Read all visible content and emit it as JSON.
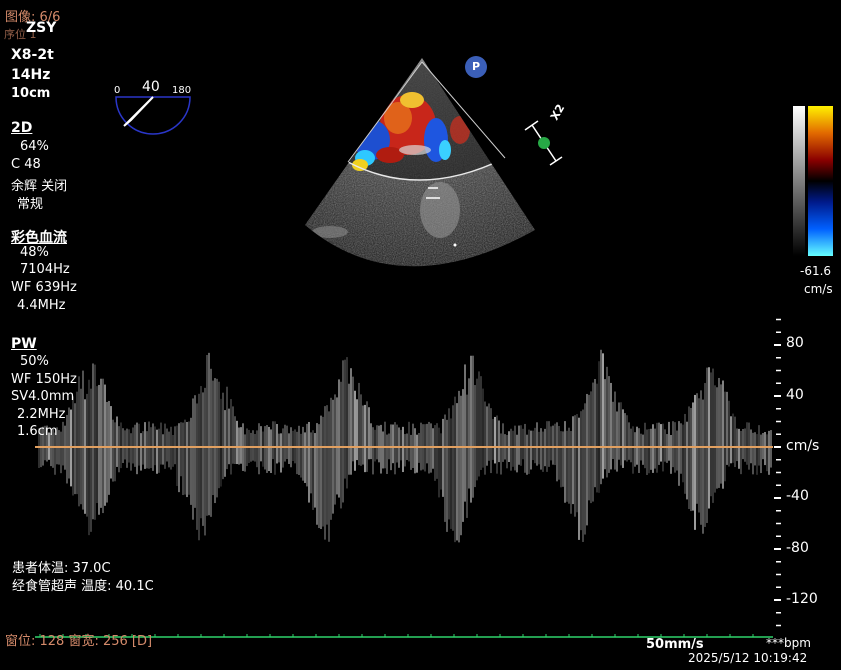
{
  "header": {
    "image_label": "图像: 6/6",
    "preset_partial": "ZSY",
    "underlay_text": "序位 1",
    "probe": "X8-2t",
    "frame_rate": "14Hz",
    "depth": "10cm"
  },
  "angle_indicator": {
    "min": "0",
    "value": "40",
    "max": "180"
  },
  "params_2d": {
    "heading": "2D",
    "gain": "64%",
    "compression": "C 48",
    "persistence": "余辉 关闭",
    "mode": "常规"
  },
  "params_color": {
    "heading": "彩色血流",
    "gain": "48%",
    "prf": "7104Hz",
    "wall_filter": "WF 639Hz",
    "frequency": "4.4MHz"
  },
  "params_pw": {
    "heading": "PW",
    "gain": "50%",
    "wall_filter": "WF 150Hz",
    "sample_volume": "SV4.0mm",
    "frequency": "2.2MHz",
    "gate_depth": "1.6cm"
  },
  "sector": {
    "p_badge": "P",
    "x2_label": "X2"
  },
  "colorbar": {
    "value": "-61.6",
    "unit": "cm/s"
  },
  "velocity_scale": {
    "ticks": [
      "80",
      "40",
      "cm/s",
      "-40",
      "-80",
      "-120"
    ],
    "tick_values": [
      80,
      40,
      0,
      -40,
      -80,
      -120
    ]
  },
  "footer": {
    "patient_temp": "患者体温: 37.0C",
    "probe_temp": "经食管超声 温度: 40.1C",
    "window": "窗位: 128 窗宽: 256 [D]",
    "sweep_speed": "50mm/s",
    "heart_rate": "***bpm",
    "datetime": "2025/5/12 10:19:42"
  },
  "colors": {
    "baseline": "#e2a060",
    "ecg": "#2fd36b",
    "panel_text": "#ffffff",
    "overlay_text": "#d48a6a",
    "angle_indicator": "#2a36c8",
    "p_badge": "#3b5fb8",
    "x2_marker": "#27a846"
  }
}
